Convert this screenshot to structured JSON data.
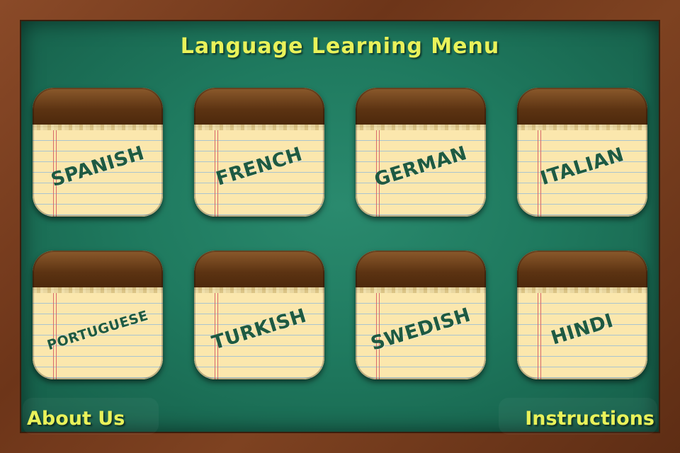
{
  "title": "Language Learning Menu",
  "languages": [
    {
      "label": "SPANISH"
    },
    {
      "label": "FRENCH"
    },
    {
      "label": "GERMAN"
    },
    {
      "label": "ITALIAN"
    },
    {
      "label": "PORTUGUESE"
    },
    {
      "label": "TURKISH"
    },
    {
      "label": "SWEDISH"
    },
    {
      "label": "HINDI"
    }
  ],
  "footer": {
    "about_label": "About Us",
    "instructions_label": "Instructions"
  },
  "colors": {
    "board": "#1f7a5f",
    "frame": "#6d3519",
    "title_text": "#e9f25a",
    "label_text": "#1e5a42",
    "paper": "#fbeab0"
  }
}
